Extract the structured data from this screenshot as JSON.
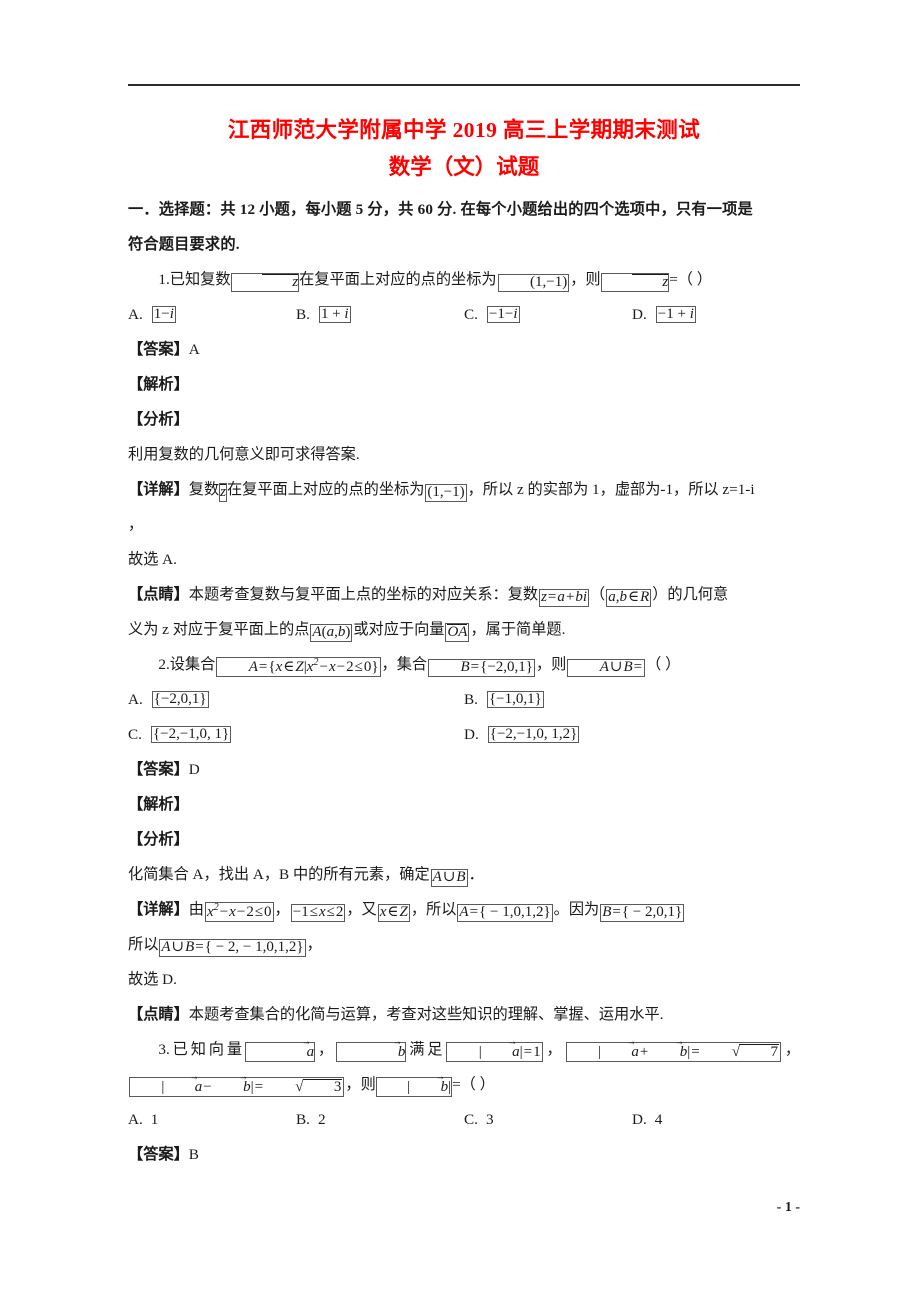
{
  "document": {
    "title": "江西师范大学附属中学 2019 高三上学期期末测试",
    "subtitle": "数学（文）试题",
    "title_color": "#ff0000",
    "page_number": "- 1 -"
  },
  "section": {
    "heading_line1": "一．选择题：共 12 小题，每小题 5 分，共 60 分. 在每个小题给出的四个选项中，只有一项是",
    "heading_line2": "符合题目要求的."
  },
  "labels": {
    "answer": "【答案】",
    "analysis_head": "【解析】",
    "analysis": "【分析】",
    "detail": "【详解】",
    "insight": "【点睛】",
    "opt_a": "A.",
    "opt_b": "B.",
    "opt_c": "C.",
    "opt_d": "D."
  },
  "q1": {
    "number": "1.",
    "stem_part1": "已知复数",
    "stem_part2": "在复平面上对应的点的坐标为",
    "stem_part3": "，则",
    "stem_part4": "=（        ）",
    "var_z": "z",
    "coord": "(1,−1)",
    "options": {
      "a": "1−i",
      "b": "1 + i",
      "c": "−1−i",
      "d": "−1 + i"
    },
    "answer": "A",
    "analysis_text": "利用复数的几何意义即可求得答案.",
    "detail_part1": "复数",
    "detail_part2": "在复平面上对应的点的坐标为",
    "detail_part3": "，所以 z 的实部为 1，虚部为-1，所以 z=1-i",
    "detail_line2": "，",
    "conclusion": "故选 A.",
    "insight_part1": "本题考查复数与复平面上点的坐标的对应关系：复数",
    "insight_eq1": "z = a + bi",
    "insight_part2": "（",
    "insight_eq2": "a,b ∈ R",
    "insight_part3": "）的几何意",
    "insight_line2_part1": "义为 z 对应于复平面上的点",
    "insight_eq3": "A(a,b)",
    "insight_line2_part2": "或对应于向量",
    "insight_eq4": "OA",
    "insight_line2_part3": "，属于简单题."
  },
  "q2": {
    "number": "2.",
    "stem_part1": "设集合",
    "stem_eq_A": "A = {x ∈ Z| x² − x − 2 ≤ 0}",
    "stem_part2": "，集合",
    "stem_eq_B": "B = {−2,0,1}",
    "stem_part3": "，则",
    "stem_eq_AuB": "A ∪ B =",
    "stem_part4": "（        ）",
    "options": {
      "a": "{−2,0,1}",
      "b": "{−1,0,1}",
      "c": "{−2,−1,0,  1}",
      "d": "{−2,−1,0,  1,2}"
    },
    "answer": "D",
    "analysis_part1": "化简集合 A，找出 A，B 中的所有元素，确定",
    "analysis_eq": "A ∪ B",
    "analysis_part2": "．",
    "detail_part1": "由",
    "detail_eq1": "x² − x − 2 ≤ 0",
    "detail_part2": "，",
    "detail_eq2": "−1 ≤ x ≤ 2",
    "detail_part3": "，又",
    "detail_eq3": "x ∈ Z",
    "detail_part4": "，所以",
    "detail_eq4": "A = { − 1,0,1,2}",
    "detail_part5": "。因为",
    "detail_eq5": "B = { − 2,0,1}",
    "detail_line2_part1": "所以",
    "detail_eq6": "A ∪ B = { − 2, − 1,0,1,2}",
    "detail_line2_part2": "，",
    "conclusion": "故选 D.",
    "insight": "本题考查集合的化简与运算，考查对这些知识的理解、掌握、运用水平."
  },
  "q3": {
    "number": "3.",
    "stem_part1": "已知向量",
    "vec_a": "a",
    "stem_part2": "，",
    "vec_b": "b",
    "stem_part3": "满足",
    "eq1": "|a| = 1",
    "stem_part4": "，",
    "eq2": "|a + b| = √7",
    "stem_part5": "，",
    "eq3": "|a−b| = √3",
    "stem_part6": "，则",
    "eq4": "|b|",
    "stem_part7": "=（        ）",
    "options": {
      "a": "1",
      "b": "2",
      "c": "3",
      "d": "4"
    },
    "answer": "B"
  }
}
